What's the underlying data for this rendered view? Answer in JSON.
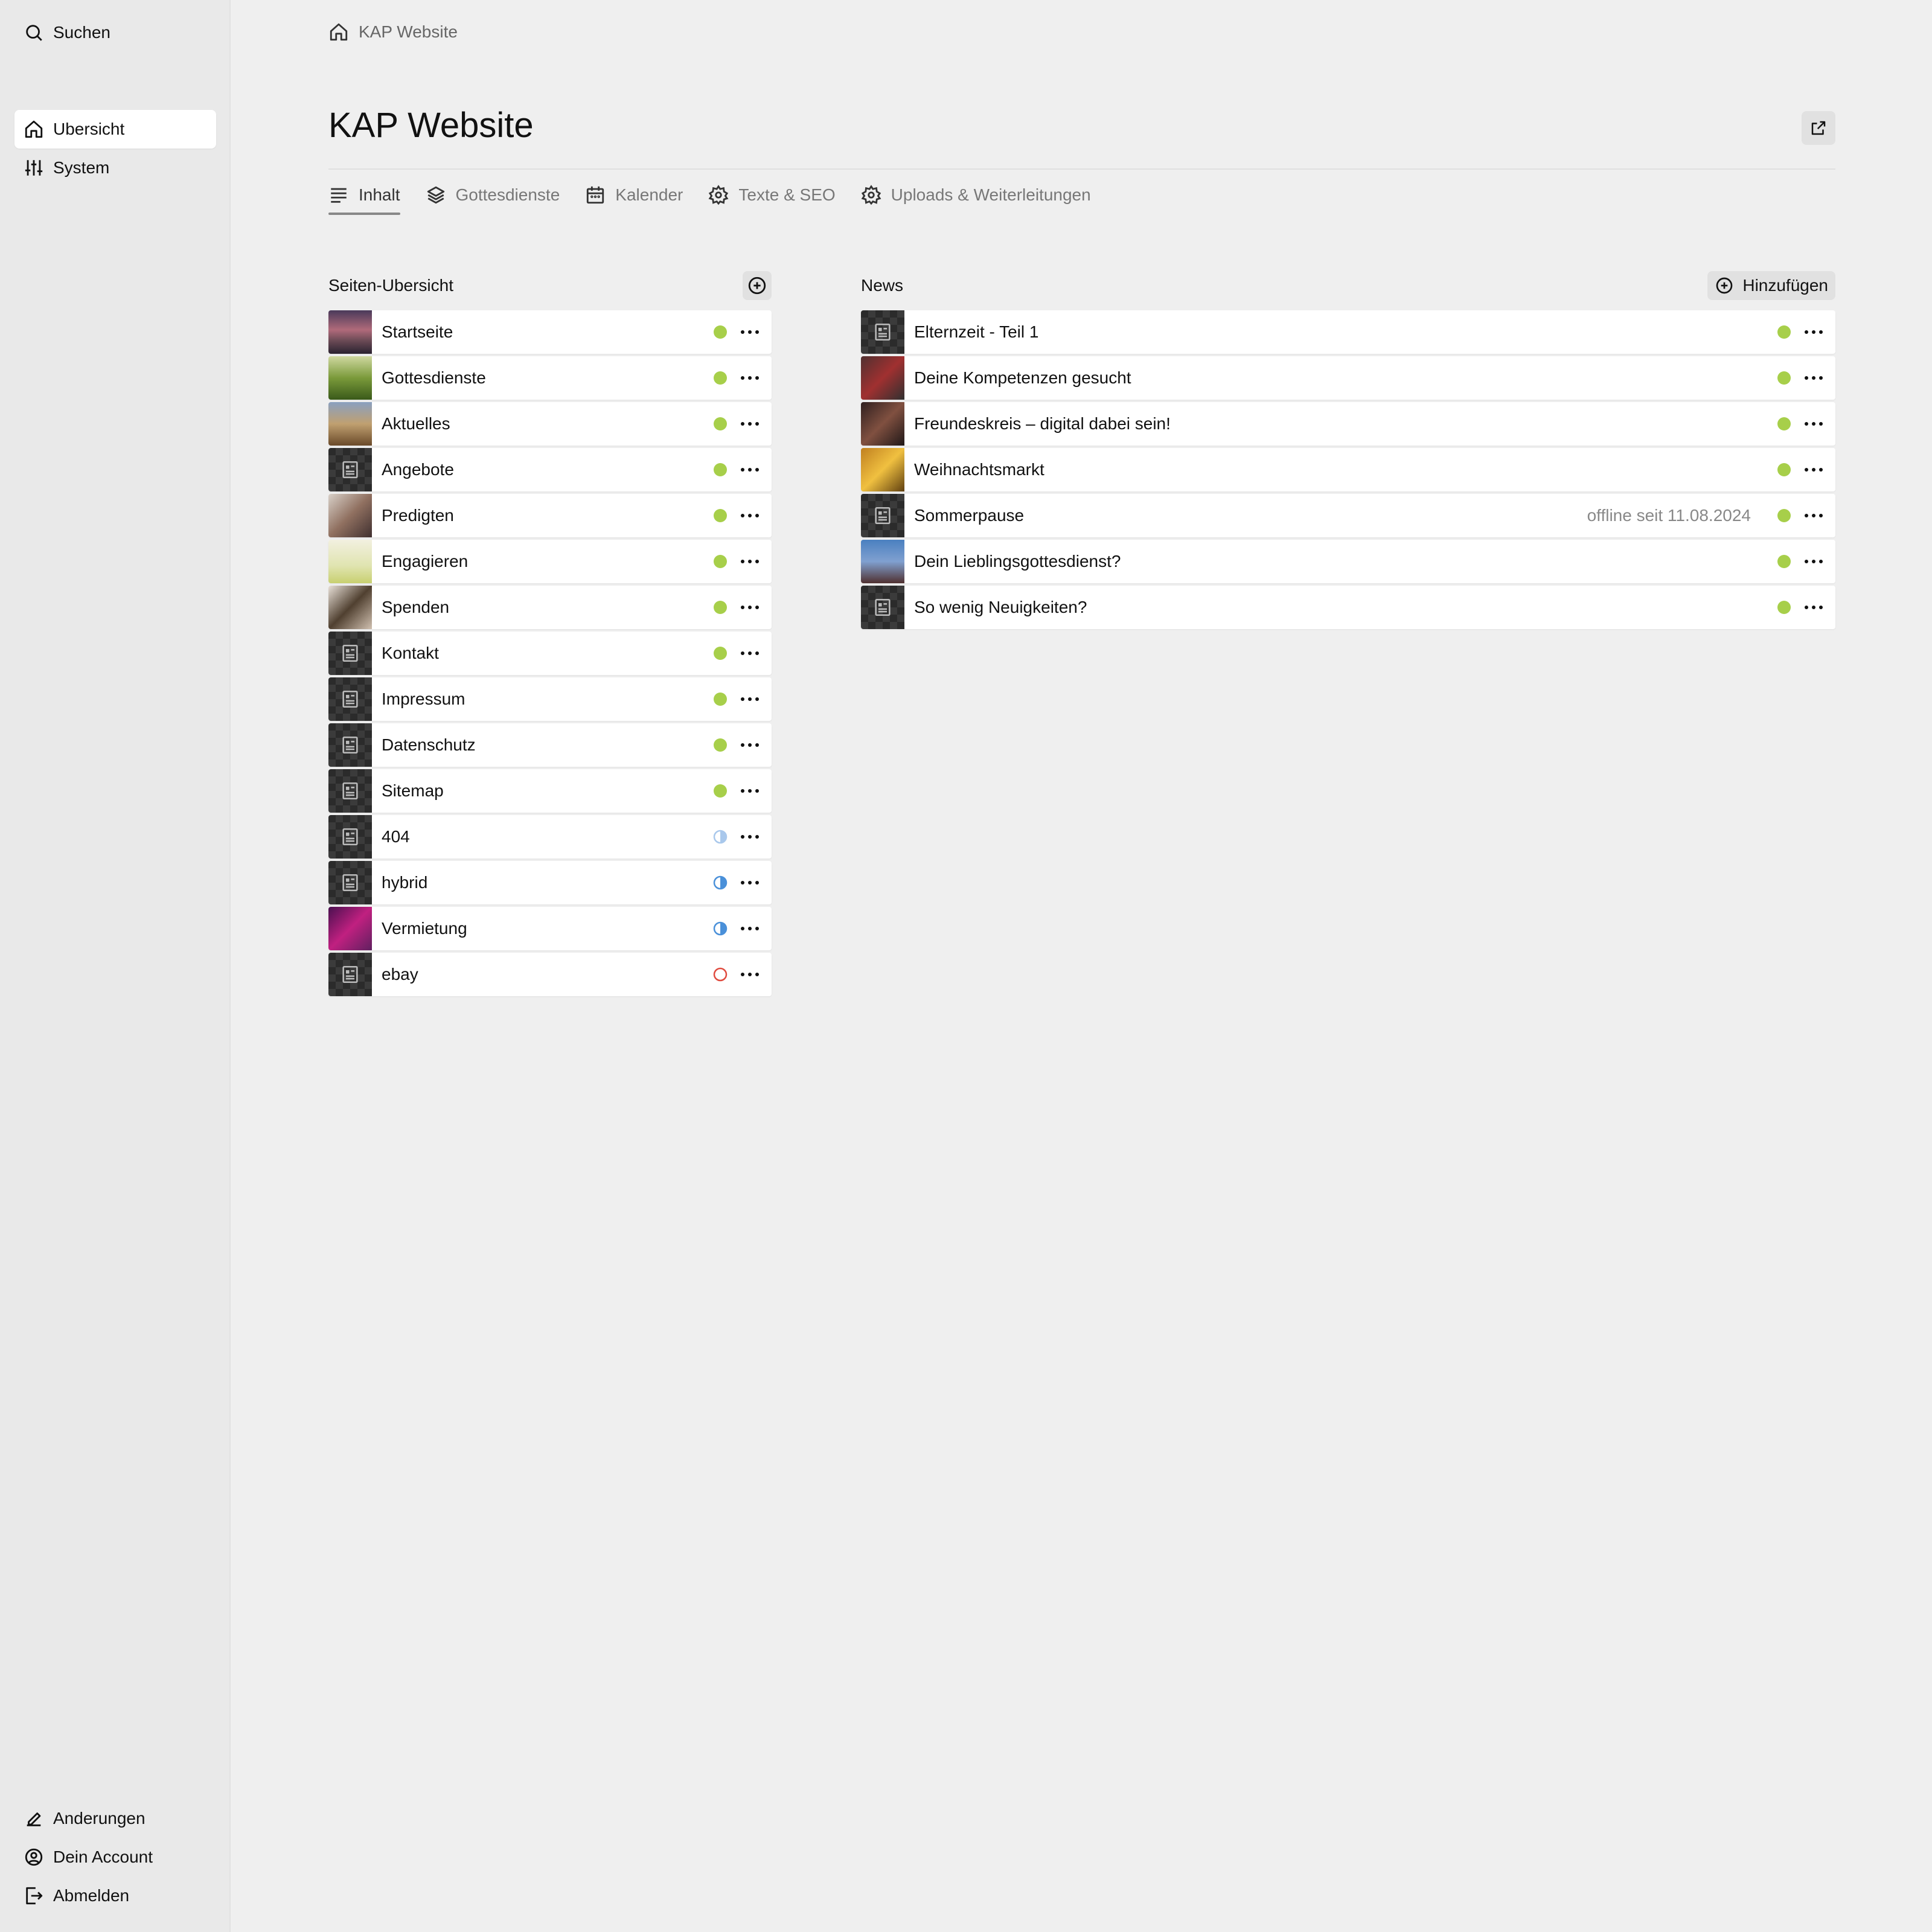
{
  "sidebar": {
    "search_label": "Suchen",
    "nav": [
      {
        "label": "Ubersicht",
        "icon": "home-icon",
        "active": true
      },
      {
        "label": "System",
        "icon": "sliders-icon",
        "active": false
      }
    ],
    "bottom": [
      {
        "label": "Anderungen",
        "icon": "pencil-icon"
      },
      {
        "label": "Dein Account",
        "icon": "user-circle-icon"
      },
      {
        "label": "Abmelden",
        "icon": "logout-icon"
      }
    ]
  },
  "breadcrumb": {
    "icon": "home-icon",
    "label": "KAP Website"
  },
  "header": {
    "title": "KAP Website",
    "open_icon": "external-link-icon"
  },
  "tabs": [
    {
      "label": "Inhalt",
      "icon": "text-lines-icon",
      "active": true
    },
    {
      "label": "Gottesdienste",
      "icon": "layers-icon",
      "active": false
    },
    {
      "label": "Kalender",
      "icon": "calendar-icon",
      "active": false
    },
    {
      "label": "Texte & SEO",
      "icon": "gear-icon",
      "active": false
    },
    {
      "label": "Uploads & Weiterleitungen",
      "icon": "gear-icon",
      "active": false
    }
  ],
  "pages": {
    "title": "Seiten-Ubersicht",
    "add_icon": "plus-circle-icon",
    "items": [
      {
        "label": "Startseite",
        "thumb": "photo",
        "status": "published"
      },
      {
        "label": "Gottesdienste",
        "thumb": "photo",
        "status": "published"
      },
      {
        "label": "Aktuelles",
        "thumb": "photo",
        "status": "published"
      },
      {
        "label": "Angebote",
        "thumb": "placeholder",
        "status": "published"
      },
      {
        "label": "Predigten",
        "thumb": "photo",
        "status": "published"
      },
      {
        "label": "Engagieren",
        "thumb": "photo",
        "status": "published"
      },
      {
        "label": "Spenden",
        "thumb": "photo",
        "status": "published"
      },
      {
        "label": "Kontakt",
        "thumb": "placeholder",
        "status": "published"
      },
      {
        "label": "Impressum",
        "thumb": "placeholder",
        "status": "published"
      },
      {
        "label": "Datenschutz",
        "thumb": "placeholder",
        "status": "published"
      },
      {
        "label": "Sitemap",
        "thumb": "placeholder",
        "status": "published"
      },
      {
        "label": "404",
        "thumb": "placeholder",
        "status": "unlisted-light"
      },
      {
        "label": "hybrid",
        "thumb": "placeholder",
        "status": "unlisted"
      },
      {
        "label": "Vermietung",
        "thumb": "photo",
        "status": "unlisted"
      },
      {
        "label": "ebay",
        "thumb": "placeholder",
        "status": "draft"
      }
    ]
  },
  "news": {
    "title": "News",
    "add_label": "Hinzufügen",
    "add_icon": "plus-circle-icon",
    "items": [
      {
        "label": "Elternzeit - Teil 1",
        "thumb": "placeholder",
        "status": "published",
        "meta": ""
      },
      {
        "label": "Deine Kompetenzen gesucht",
        "thumb": "photo",
        "status": "published",
        "meta": ""
      },
      {
        "label": "Freundeskreis – digital dabei sein!",
        "thumb": "photo",
        "status": "published",
        "meta": ""
      },
      {
        "label": "Weihnachtsmarkt",
        "thumb": "photo",
        "status": "published",
        "meta": ""
      },
      {
        "label": "Sommerpause",
        "thumb": "placeholder",
        "status": "published",
        "meta": "offline seit 11.08.2024"
      },
      {
        "label": "Dein Lieblingsgottesdienst?",
        "thumb": "photo",
        "status": "published",
        "meta": ""
      },
      {
        "label": "So wenig Neuigkeiten?",
        "thumb": "placeholder",
        "status": "published",
        "meta": ""
      }
    ]
  },
  "colors": {
    "published": "#a7cf4a",
    "unlisted": "#4a90d9",
    "unlisted_light": "#a9c8ec",
    "draft": "#e04b3f"
  }
}
